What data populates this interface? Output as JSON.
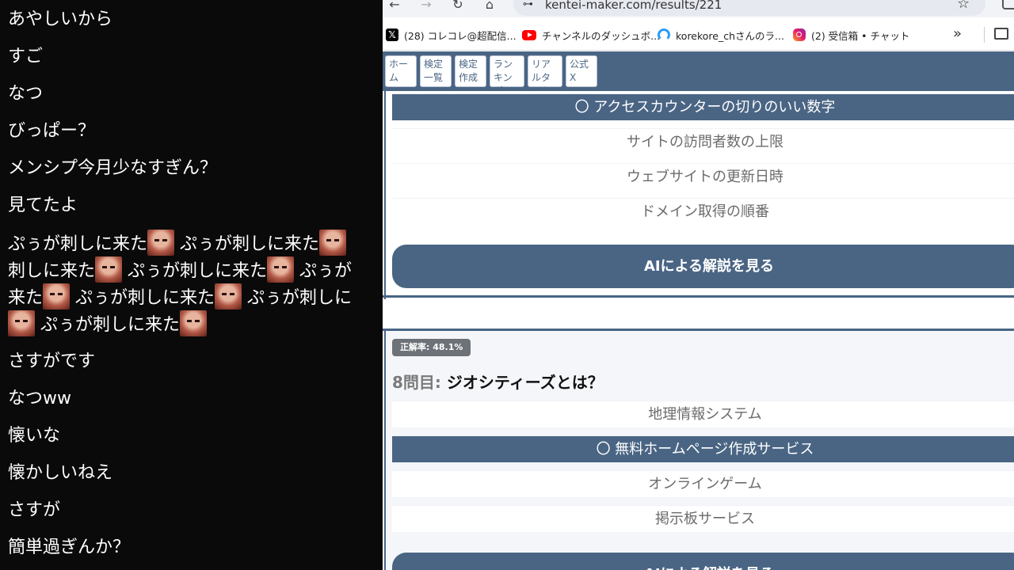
{
  "comments": [
    {
      "text": "あやしいから"
    },
    {
      "text": "すご"
    },
    {
      "text": "なつ"
    },
    {
      "text": "びっぱー？"
    },
    {
      "text": "メンシプ今月少なすぎん？"
    },
    {
      "text": "見てたよ"
    },
    {
      "text": "さすがです"
    },
    {
      "text": "なつww"
    },
    {
      "text": "懐いな"
    },
    {
      "text": "懐かしいねえ"
    },
    {
      "text": "さすが"
    },
    {
      "text": "簡単過ぎんか？"
    }
  ],
  "spam": {
    "line1a": "ぷぅが刺しに来た",
    "line1b": "ぷぅが刺しに来た",
    "line2a": "刺しに来た",
    "line2b": "ぷぅが刺しに来た",
    "line2c": "ぷぅが",
    "line3a": "来た",
    "line3b": "ぷぅが刺しに来た",
    "line3c": "ぷぅが刺しに",
    "line4a": "ぷぅが刺しに来た"
  },
  "browser": {
    "url": "kentei-maker.com/results/221",
    "nav": {
      "back": "←",
      "forward": "→",
      "reload": "↻",
      "home": "⌂",
      "star": "☆"
    },
    "bookmarks": [
      {
        "label": "(28) コレコレ@超配信...",
        "icon": "x-icon"
      },
      {
        "label": "チャンネルのダッシュボ...",
        "icon": "youtube-icon"
      },
      {
        "label": "korekore_chさんのラ...",
        "icon": "korekore-icon"
      },
      {
        "label": "(2) 受信箱 • チャット",
        "icon": "instagram-icon"
      }
    ],
    "more": "»"
  },
  "site": {
    "nav": [
      "ホーム",
      "検定一覧",
      "検定作成",
      "ランキング",
      "リアルタイム",
      "公式X"
    ],
    "colors": {
      "primary": "#4a6584",
      "badge": "#6c7278"
    }
  },
  "question7": {
    "options": [
      {
        "text": "〇 アクセスカウンターの切りのいい数字",
        "correct": true
      },
      {
        "text": "サイトの訪問者数の上限",
        "correct": false
      },
      {
        "text": "ウェブサイトの更新日時",
        "correct": false
      },
      {
        "text": "ドメイン取得の順番",
        "correct": false
      }
    ],
    "ai_button": "AIによる解説を見る"
  },
  "question8": {
    "badge": "正解率: 48.1%",
    "number": "8問目:",
    "title": "ジオシティーズとは？",
    "options": [
      {
        "text": "地理情報システム",
        "correct": false
      },
      {
        "text": "〇 無料ホームページ作成サービス",
        "correct": true
      },
      {
        "text": "オンラインゲーム",
        "correct": false
      },
      {
        "text": "掲示板サービス",
        "correct": false
      }
    ],
    "ai_button": "AIによる解説を見る"
  }
}
